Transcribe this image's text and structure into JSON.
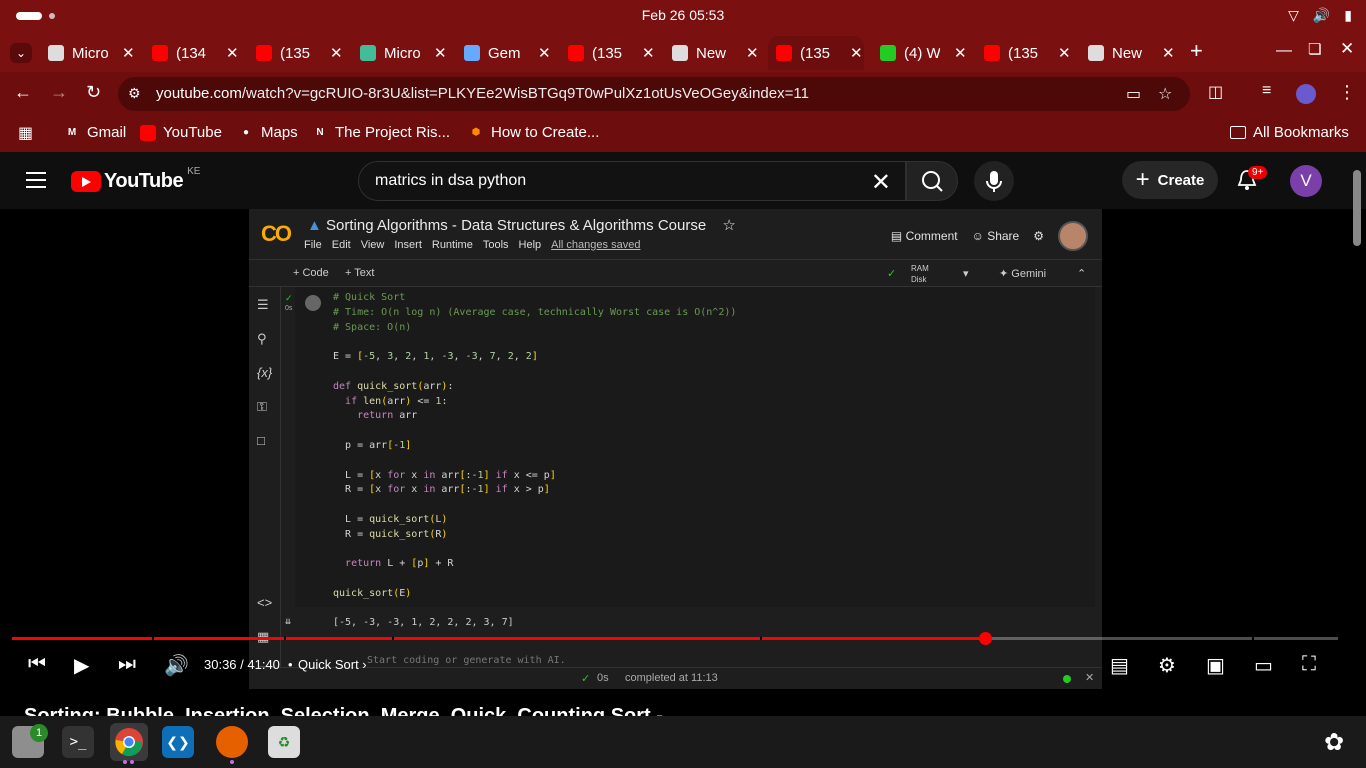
{
  "os": {
    "clock": "Feb 26  05:53"
  },
  "tabs": [
    {
      "label": "Micro",
      "icon": "openai-icon",
      "color": "#ddd"
    },
    {
      "label": "(134",
      "icon": "youtube-icon",
      "color": "#f00"
    },
    {
      "label": "(135",
      "icon": "youtube-icon",
      "color": "#f00"
    },
    {
      "label": "Micro",
      "icon": "copilot-icon",
      "color": "#4b9"
    },
    {
      "label": "Gem",
      "icon": "gemini-icon",
      "color": "#6af"
    },
    {
      "label": "(135",
      "icon": "youtube-icon",
      "color": "#f00"
    },
    {
      "label": "New",
      "icon": "openai-icon",
      "color": "#ddd"
    },
    {
      "label": "(135",
      "icon": "youtube-icon",
      "color": "#f00"
    },
    {
      "label": "(4) W",
      "icon": "whatsapp-icon",
      "color": "#2c2"
    },
    {
      "label": "(135",
      "icon": "youtube-icon",
      "color": "#f00"
    },
    {
      "label": "New",
      "icon": "openai-icon",
      "color": "#ddd"
    }
  ],
  "address": {
    "domain": "youtube.com",
    "path": "/watch?v=gcRUIO-8r3U&list=PLKYEe2WisBTGq9T0wPulXz1otUsVeOGey&index=11"
  },
  "bookmarks": [
    {
      "label": "Gmail",
      "icon": "gmail-icon"
    },
    {
      "label": "YouTube",
      "icon": "youtube-icon"
    },
    {
      "label": "Maps",
      "icon": "maps-icon"
    },
    {
      "label": "The Project Ris...",
      "icon": "notion-icon"
    },
    {
      "label": "How to Create...",
      "icon": "site-icon"
    }
  ],
  "all_bookmarks": "All Bookmarks",
  "youtube": {
    "logo_text": "YouTube",
    "country": "KE",
    "search_value": "matrics in dsa python",
    "create_label": "Create",
    "notif_count": "9+",
    "avatar_letter": "V"
  },
  "colab": {
    "logo": "CO",
    "title": "Sorting Algorithms - Data Structures & Algorithms Course",
    "menu": [
      "File",
      "Edit",
      "View",
      "Insert",
      "Runtime",
      "Tools",
      "Help"
    ],
    "saved": "All changes saved",
    "comment": "Comment",
    "share": "Share",
    "add_code": "+ Code",
    "add_text": "+ Text",
    "ram": "RAM",
    "disk": "Disk",
    "gemini": "Gemini",
    "exec_time": "0s",
    "output": "[-5, -3, -3, 1, 2, 2, 2, 3, 7]",
    "hint": "Start coding or generate with AI.",
    "status_time": "0s",
    "status_text": "completed at 11:13"
  },
  "player": {
    "time": "30:36 / 41:40",
    "chapter": "Quick Sort",
    "progress": 0.734
  },
  "video_title": "Sorting: Bubble, Insertion, Selection, Merge, Quick, Counting Sort -",
  "taskbar": {
    "files_badge": "1"
  }
}
